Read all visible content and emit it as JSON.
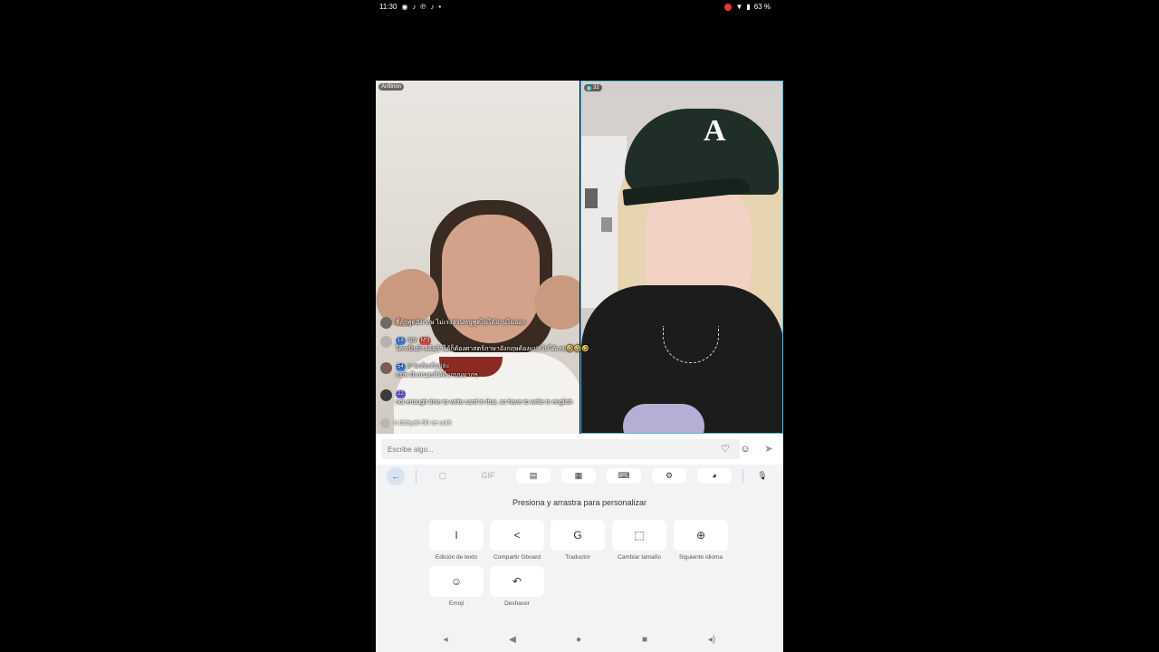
{
  "status_bar": {
    "time": "11:30",
    "left_icons": [
      "location-icon",
      "tiktok-icon",
      "pinterest-icon",
      "tiktok-icon",
      "dot-icon"
    ],
    "battery": "63 %",
    "right_icons": [
      "record-icon",
      "wifi-icon",
      "battery-icon"
    ]
  },
  "video": {
    "host_label": "Anfitrión",
    "viewer_count": "32"
  },
  "chat": [
    {
      "badge": "",
      "user": "",
      "text": "พี่ถ้าพูดอังกฤษ ไม่เร่งส่วนหนูพูดไม่ได้อ่านไม่ออก"
    },
    {
      "badge": "18",
      "badge2": "Nº3",
      "user": "spy",
      "text": "ใครเป็นบ้างคือถ้าได้ก็ต้องศาสตร์ภาษาอังกฤษต้องแปลไม่ได้เลย🤣🤣🤣"
    },
    {
      "badge": "54",
      "badge2": "",
      "user": "อายเด้อเต้อยู่ล่ะ",
      "text": "แมพ มีแน่นอนได้ที่แกบนมากๆ"
    },
    {
      "badge": "22",
      "badge2": "",
      "user": "",
      "text": "not enough time to write card in thai, so have to write in english"
    }
  ],
  "join_text": "n.dahyah-50 se unió",
  "comment_bar": {
    "placeholder": "Escribe algo...",
    "icons": [
      "heart-shield-icon",
      "emoji-icon",
      "send-icon"
    ]
  },
  "keyboard": {
    "toolbar": [
      "back-arrow-icon",
      "sticker-icon",
      "GIF",
      "clipboard-icon",
      "one-hand-icon",
      "keyboard-icon",
      "settings-icon",
      "theme-icon",
      "mic-icon"
    ],
    "gif_label": "GIF",
    "title": "Presiona y arrastra para personalizar",
    "keys": [
      {
        "icon": "text-edit-icon",
        "label": "Edición de texto"
      },
      {
        "icon": "share-icon",
        "label": "Compartir Gboard"
      },
      {
        "icon": "translate-icon",
        "label": "Traductor"
      },
      {
        "icon": "resize-icon",
        "label": "Cambiar tamaño"
      },
      {
        "icon": "globe-icon",
        "label": "Siguiente idioma"
      },
      {
        "icon": "emoji-icon",
        "label": "Emoji"
      },
      {
        "icon": "undo-icon",
        "label": "Deshacer"
      }
    ]
  },
  "navbar": [
    "volume-down-icon",
    "back-icon",
    "home-icon",
    "recents-icon",
    "volume-up-icon"
  ]
}
